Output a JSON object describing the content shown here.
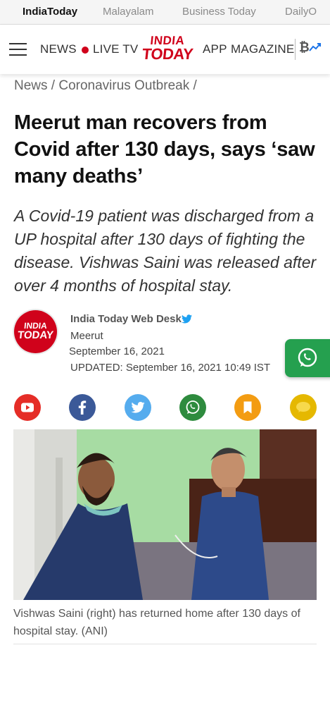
{
  "network": {
    "items": [
      "IndiaToday",
      "Malayalam",
      "Business Today",
      "DailyO"
    ]
  },
  "header": {
    "menu_icon": "hamburger-menu-icon",
    "news_label": "NEWS",
    "live_label": "LIVE TV",
    "logo_line1": "INDIA",
    "logo_line2": "TODAY",
    "app_label": "APP",
    "magazine_label": "MAGAZINE",
    "crypto_icon": "bitcoin-trend-icon"
  },
  "article": {
    "breadcrumb": "News / Coronavirus Outbreak /",
    "headline": "Meerut man recovers from Covid after 130 days, says ‘saw many deaths’",
    "summary": "A Covid-19 patient was discharged from a UP hospital after 130 days of fighting the disease. Vishwas Saini was released after over 4 months of hospital stay.",
    "author": {
      "logo_line1": "INDIA",
      "logo_line2": "TODAY",
      "name": "India Today Web Desk",
      "location": "Meerut",
      "date": "September 16, 2021",
      "updated": "UPDATED: September 16, 2021 10:49 IST"
    },
    "share": [
      {
        "name": "youtube",
        "color": "#e52d27"
      },
      {
        "name": "facebook",
        "color": "#3b5998"
      },
      {
        "name": "twitter",
        "color": "#55acee"
      },
      {
        "name": "whatsapp",
        "color": "#2e8b3e"
      },
      {
        "name": "bookmark",
        "color": "#f39c12"
      },
      {
        "name": "comment",
        "color": "#f1c40f"
      }
    ],
    "caption": "Vishwas Saini (right) has returned home after 130 days of hospital stay. (ANI)"
  },
  "colors": {
    "brand_red": "#d0021b",
    "whatsapp_green": "#25a04f"
  }
}
